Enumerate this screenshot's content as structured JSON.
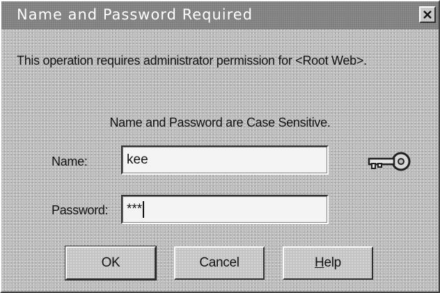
{
  "window": {
    "title": "Name and Password Required",
    "close_icon": "close-x-icon"
  },
  "message": "This operation requires administrator permission for <Root Web>.",
  "case_note": "Name and Password are Case Sensitive.",
  "fields": {
    "name": {
      "label": "Name:",
      "value": "kee"
    },
    "password": {
      "label": "Password:",
      "value": "***"
    }
  },
  "key_icon": "key-icon",
  "buttons": {
    "ok": "OK",
    "cancel": "Cancel",
    "help_mnemonic": "H",
    "help_rest": "elp"
  }
}
